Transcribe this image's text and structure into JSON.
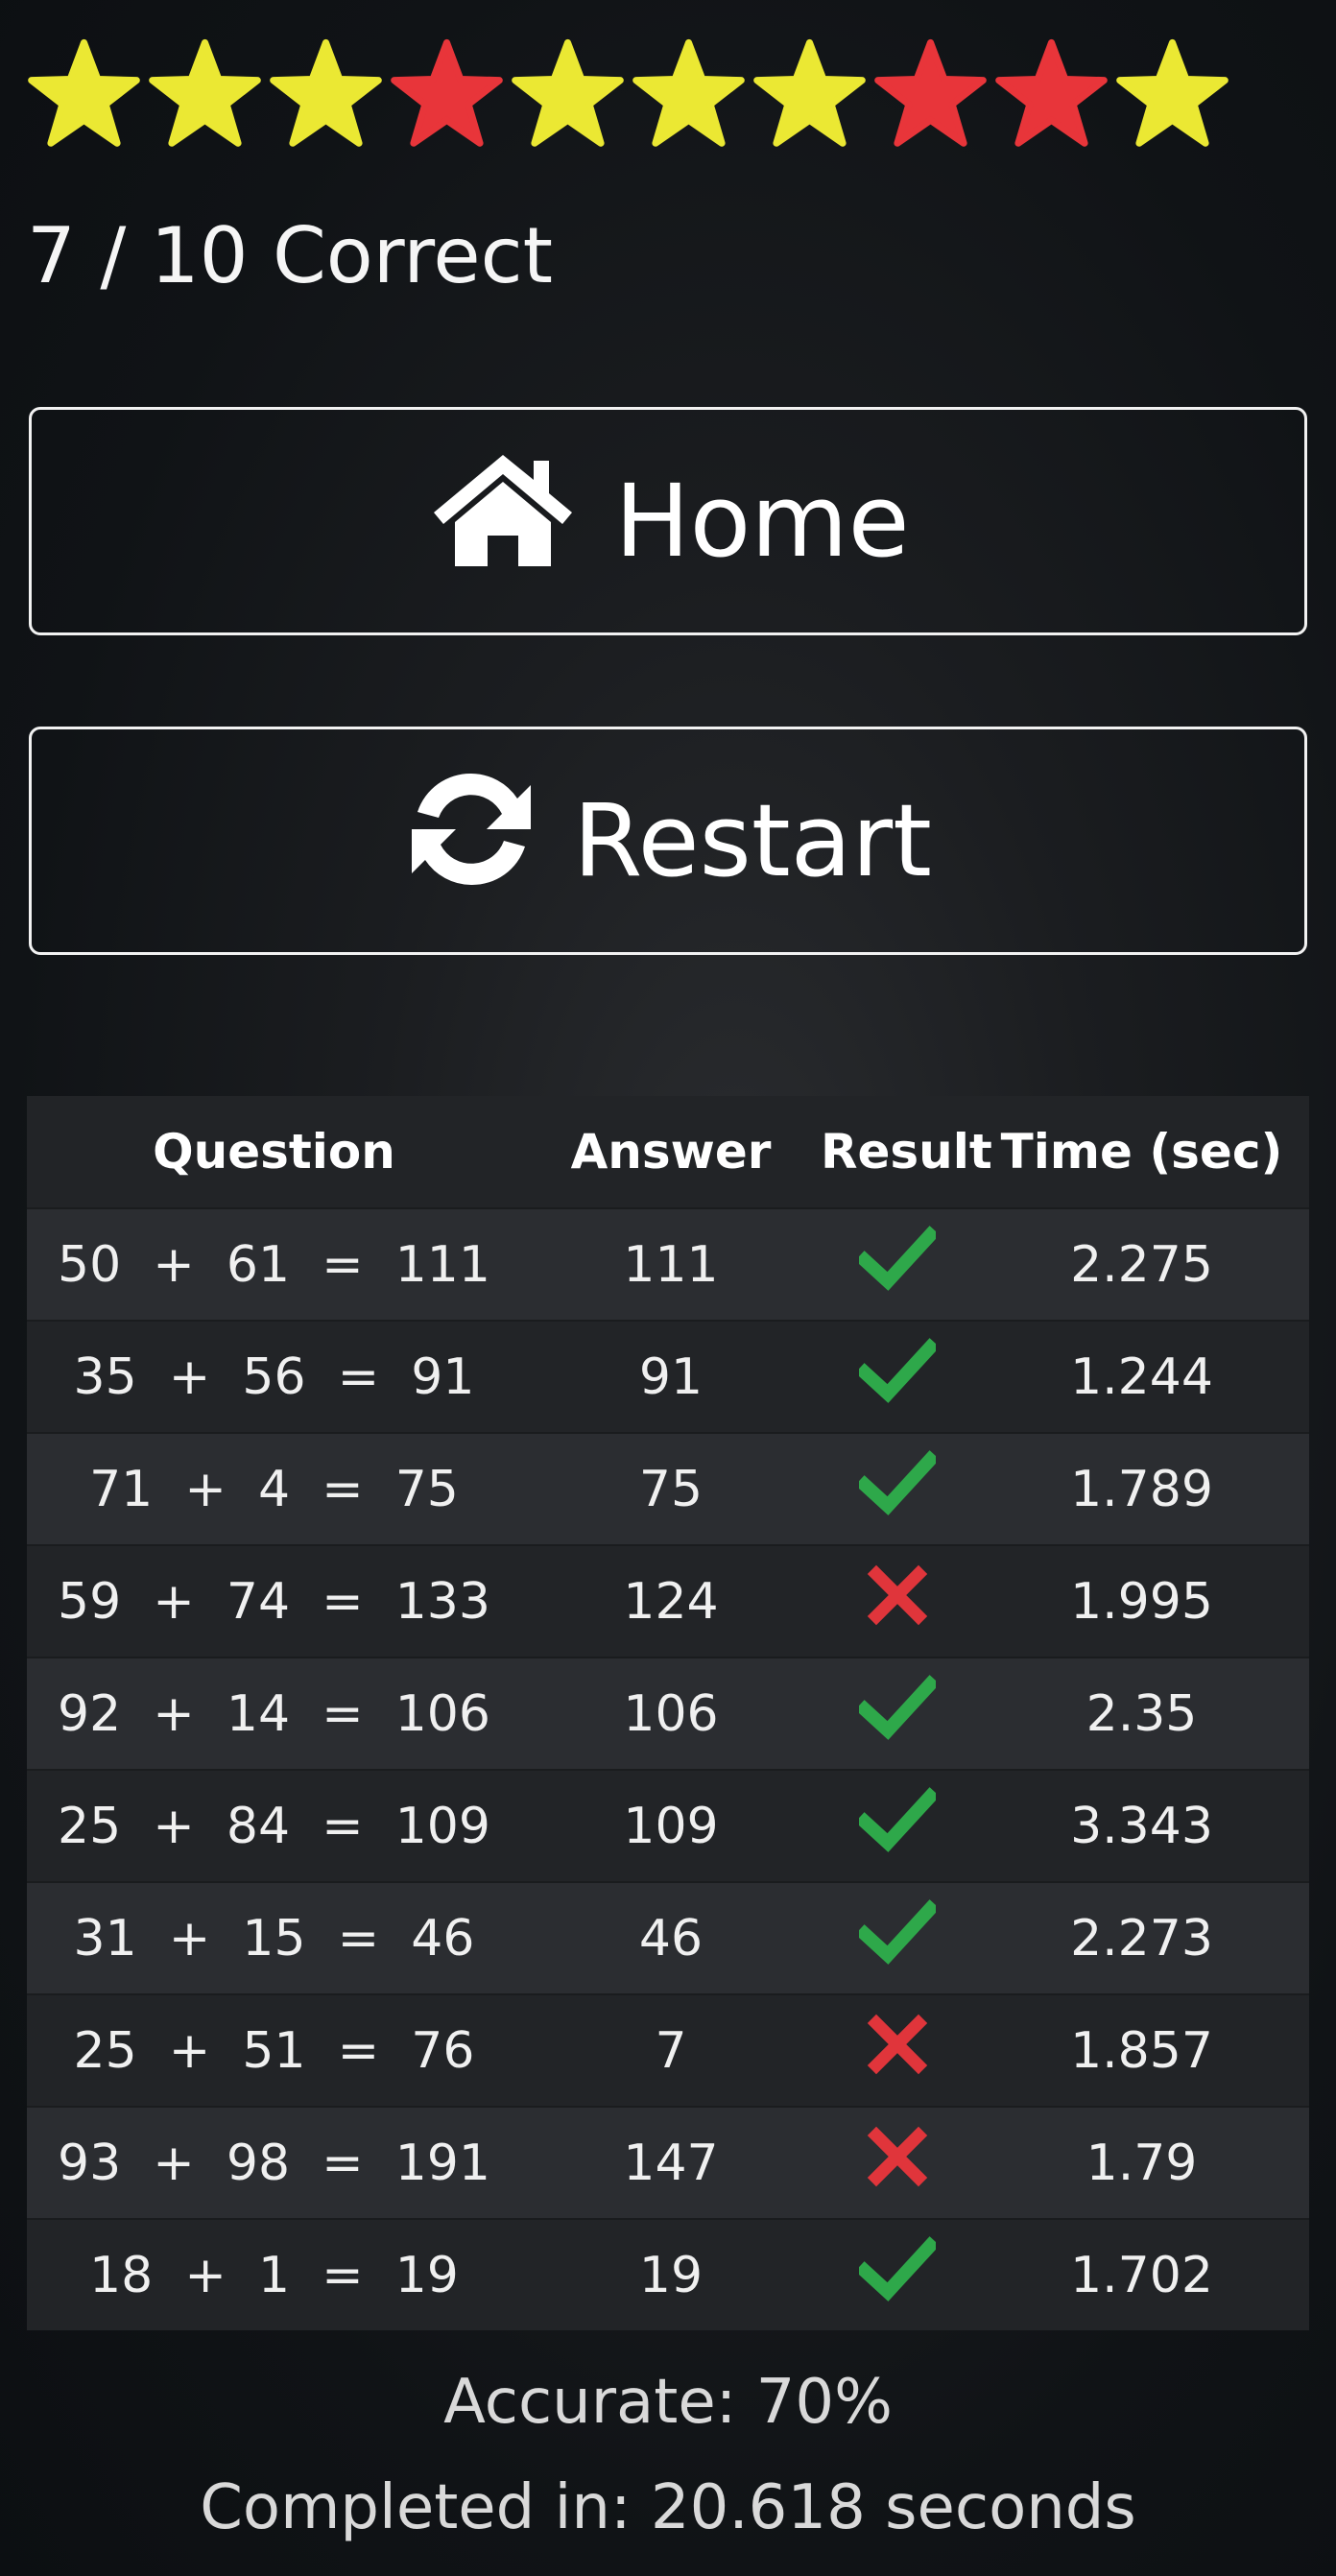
{
  "rating": {
    "stars": [
      "yellow",
      "yellow",
      "yellow",
      "red",
      "yellow",
      "yellow",
      "yellow",
      "red",
      "red",
      "yellow"
    ],
    "colors": {
      "yellow": "#ebe833",
      "red": "#e8353a"
    }
  },
  "score_text": "7 / 10 Correct",
  "buttons": {
    "home_label": "Home",
    "home_icon": "home-icon",
    "restart_label": "Restart",
    "restart_icon": "refresh-icon"
  },
  "table": {
    "headers": [
      "Question",
      "Answer",
      "Result",
      "Time (sec)"
    ],
    "rows": [
      {
        "question": "50  +  61  =  111",
        "answer": "111",
        "result": "correct",
        "time": "2.275"
      },
      {
        "question": "35  +  56  =  91",
        "answer": "91",
        "result": "correct",
        "time": "1.244"
      },
      {
        "question": "71  +  4  =  75",
        "answer": "75",
        "result": "correct",
        "time": "1.789"
      },
      {
        "question": "59  +  74  =  133",
        "answer": "124",
        "result": "wrong",
        "time": "1.995"
      },
      {
        "question": "92  +  14  =  106",
        "answer": "106",
        "result": "correct",
        "time": "2.35"
      },
      {
        "question": "25  +  84  =  109",
        "answer": "109",
        "result": "correct",
        "time": "3.343"
      },
      {
        "question": "31  +  15  =  46",
        "answer": "46",
        "result": "correct",
        "time": "2.273"
      },
      {
        "question": "25  +  51  =  76",
        "answer": "7",
        "result": "wrong",
        "time": "1.857"
      },
      {
        "question": "93  +  98  =  191",
        "answer": "147",
        "result": "wrong",
        "time": "1.79"
      },
      {
        "question": "18  +  1  =  19",
        "answer": "19",
        "result": "correct",
        "time": "1.702"
      }
    ],
    "result_colors": {
      "correct": "#2ea84a",
      "wrong": "#e0353b"
    },
    "result_icons": {
      "correct": "checkmark-icon",
      "wrong": "cross-icon"
    }
  },
  "summary": {
    "accuracy": "Accurate: 70%",
    "completed": "Completed in: 20.618 seconds"
  }
}
